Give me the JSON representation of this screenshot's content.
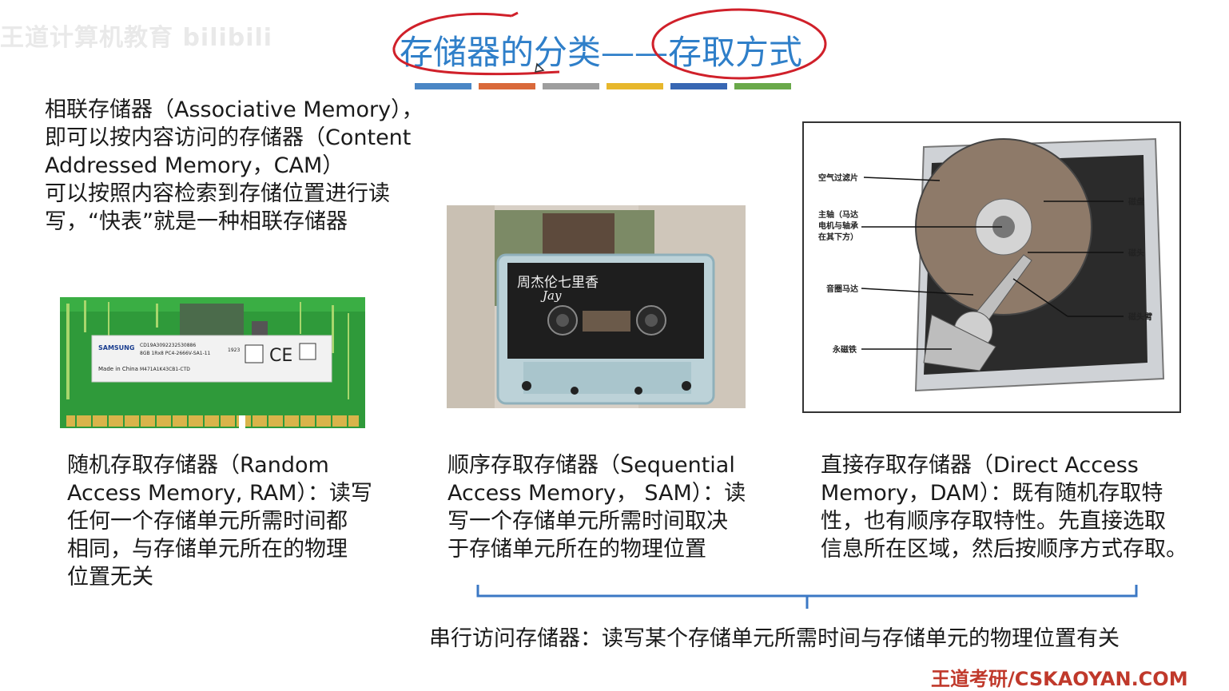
{
  "watermark": "王道计算机教育 bilibili",
  "title": {
    "left": "存储器的分类",
    "dash": "——",
    "right": "存取方式"
  },
  "stripe_colors": [
    "#4a86c5",
    "#d9693a",
    "#9e9e9e",
    "#e7b72c",
    "#3867b3",
    "#6aa94a"
  ],
  "cam": {
    "line1": "相联存储器（Associative Memory），",
    "line2": "即可以按内容访问的存储器（Content",
    "line3": "Addressed Memory，CAM）",
    "line4": "可以按照内容检索到存储位置进行读",
    "line5": "写，“快表”就是一种相联存储器"
  },
  "ram_module": {
    "brand": "SAMSUNG",
    "label_line1": "CD19A3092232530886",
    "label_line2": "8GB 1Rx8 PC4-2666V-SA1-11",
    "label_line3": "M471A1K43CB1-CTD",
    "made_in": "Made in China",
    "code": "1923"
  },
  "cassette": {
    "title": "周杰伦七里香",
    "sig": "Jay"
  },
  "hdd": {
    "labels": {
      "air_filter": "空气过滤片",
      "spindle_1": "主轴（马达",
      "spindle_2": "电机与轴承",
      "spindle_3": "在其下方）",
      "voice_coil": "音圈马达",
      "magnet": "永磁铁",
      "platter": "磁盘",
      "head": "磁头",
      "arm": "磁头臂"
    }
  },
  "ram": {
    "line1": "随机存取存储器（Random",
    "line2": "Access Memory, RAM）：读写",
    "line3": "任何一个存储单元所需时间都",
    "line4": "相同，与存储单元所在的物理",
    "line5": "位置无关"
  },
  "sam": {
    "line1": "顺序存取存储器（Sequential",
    "line2": "Access Memory， SAM）：读",
    "line3": "写一个存储单元所需时间取决",
    "line4": "于存储单元所在的物理位置"
  },
  "dam": {
    "line1": "直接存取存储器（Direct Access",
    "line2": "Memory，DAM）：既有随机存取特",
    "line3": "性，也有顺序存取特性。先直接选取",
    "line4": "信息所在区域，然后按顺序方式存取。"
  },
  "serial": "串行访问存储器：读写某个存储单元所需时间与存储单元的物理位置有关",
  "footer": "王道考研/CSKAOYAN.COM",
  "colors": {
    "title": "#2f7fc9",
    "annotation": "#d0202a",
    "brace": "#3b78c4",
    "footer": "#c0392b"
  }
}
